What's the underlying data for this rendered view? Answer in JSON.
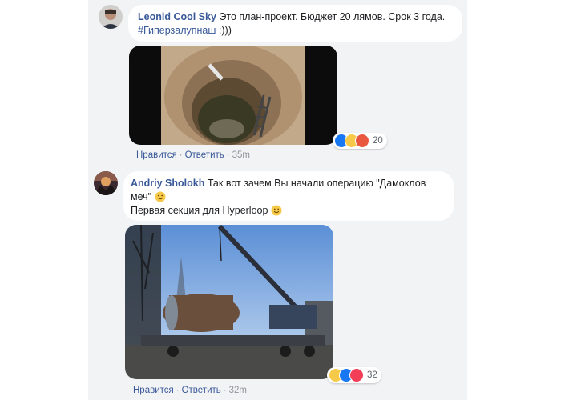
{
  "comments": [
    {
      "author": "Leonid Cool Sky",
      "text": "Это план-проект. Бюджет 20 лямов. Срок 3 года.",
      "hashtag": "#Гиперзалупнаш",
      "trailer": " :)))",
      "reactions": {
        "icons": [
          "like-icon",
          "haha-icon",
          "angry-icon"
        ],
        "count": "20"
      },
      "like_label": "Нравится",
      "reply_label": "Ответить",
      "time": "35m"
    },
    {
      "author": "Andriy Sholokh",
      "line1": "Так вот зачем Вы начали операцию \"Дамоклов меч\"",
      "line2": "Первая секция для Hyperloop",
      "reactions": {
        "icons": [
          "haha-icon",
          "like-icon",
          "love-icon"
        ],
        "count": "32"
      },
      "like_label": "Нравится",
      "reply_label": "Ответить",
      "time": "32m"
    }
  ],
  "colors": {
    "link": "#385898",
    "meta": "#90949c",
    "feed_bg": "#f2f3f5"
  }
}
